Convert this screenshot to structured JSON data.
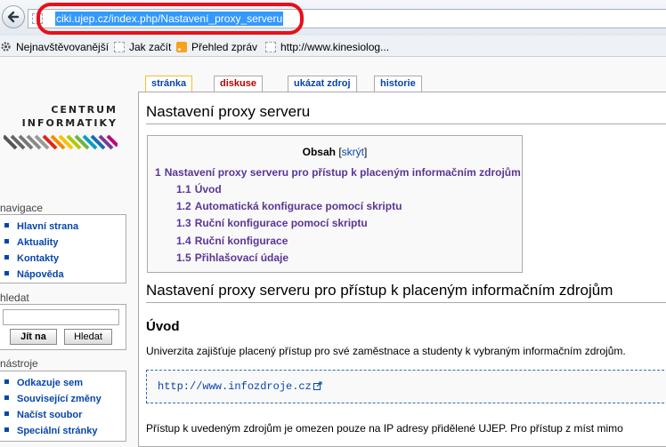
{
  "browser": {
    "url": "ciki.ujep.cz/index.php/Nastavení_proxy_serveru",
    "bookmarks": [
      {
        "label": "Nejnavštěvovanější",
        "icon": "gear-icon"
      },
      {
        "label": "Jak začít",
        "icon": "blank-page-icon"
      },
      {
        "label": "Přehled zpráv",
        "icon": "rss-icon"
      },
      {
        "label": "http://www.kinesiolog...",
        "icon": "blank-page-icon"
      }
    ],
    "highlight_color": "#e8101a"
  },
  "logo": {
    "line1": "CENTRUM",
    "line2": "INFORMATIKY"
  },
  "sidebar": {
    "navigation": {
      "title": "navigace",
      "items": [
        "Hlavní strana",
        "Aktuality",
        "Kontakty",
        "Nápověda"
      ]
    },
    "search": {
      "title": "hledat",
      "go_label": "Jít na",
      "search_label": "Hledat",
      "value": ""
    },
    "tools": {
      "title": "nástroje",
      "items": [
        "Odkazuje sem",
        "Související změny",
        "Načíst soubor",
        "Speciální stránky"
      ]
    }
  },
  "tabs": [
    {
      "label": "stránka",
      "selected": true
    },
    {
      "label": "diskuse",
      "selected": false
    },
    {
      "label": "ukázat zdroj",
      "selected": false
    },
    {
      "label": "historie",
      "selected": false
    }
  ],
  "content": {
    "title": "Nastavení proxy serveru",
    "toc": {
      "title": "Obsah",
      "toggle": "skrýt",
      "items": [
        {
          "num": "1",
          "text": "Nastavení proxy serveru pro přístup k placeným informačním zdrojům"
        },
        {
          "num": "1.1",
          "text": "Úvod"
        },
        {
          "num": "1.2",
          "text": "Automatická konfigurace pomocí skriptu"
        },
        {
          "num": "1.3",
          "text": "Ruční konfigurace pomocí skriptu"
        },
        {
          "num": "1.4",
          "text": "Ruční konfigurace"
        },
        {
          "num": "1.5",
          "text": "Přihlašovací údaje"
        }
      ]
    },
    "section_heading": "Nastavení proxy serveru pro přístup k placeným informačním zdrojům",
    "subsection_heading": "Úvod",
    "intro_text": "Univerzita zajišťuje placený přístup pro své zaměstnace a studenty k vybraným informačním zdrojům.",
    "code_link": "http://www.infozdroje.cz",
    "paragraph2": "Přístup k uvedeným zdrojům je omezen pouze na IP adresy přidělené UJEP. Pro přístup z míst mimo"
  },
  "colors": {
    "link": "#0645ad",
    "visited": "#5a3696",
    "new_link": "#ba0000",
    "selection": "#3399ff"
  }
}
